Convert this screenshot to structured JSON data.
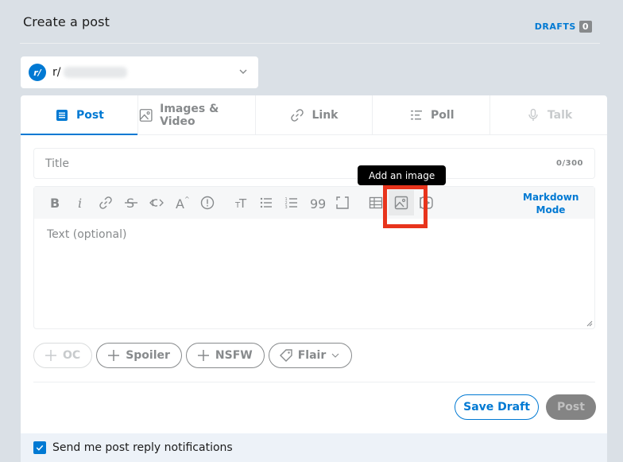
{
  "header": {
    "title": "Create a post",
    "drafts_label": "DRAFTS",
    "drafts_count": "0"
  },
  "community": {
    "avatar_text": "r/",
    "prefix": "r/"
  },
  "tabs": [
    {
      "label": "Post",
      "icon": "post-icon",
      "state": "active"
    },
    {
      "label": "Images & Video",
      "icon": "image-icon",
      "state": "normal"
    },
    {
      "label": "Link",
      "icon": "link-icon",
      "state": "normal"
    },
    {
      "label": "Poll",
      "icon": "poll-icon",
      "state": "normal"
    },
    {
      "label": "Talk",
      "icon": "microphone-icon",
      "state": "disabled"
    }
  ],
  "title_field": {
    "placeholder": "Title",
    "char_count": "0/300"
  },
  "tooltip": {
    "text": "Add an image"
  },
  "toolbar": {
    "markdown_mode_line1": "Markdown",
    "markdown_mode_line2": "Mode",
    "buttons": [
      "bold-icon",
      "italic-icon",
      "link-icon",
      "strikethrough-icon",
      "inline-code-icon",
      "superscript-icon",
      "spoiler-icon",
      "heading-icon",
      "bulleted-list-icon",
      "numbered-list-icon",
      "quote-block-icon",
      "code-block-icon",
      "table-icon",
      "image-icon",
      "video-icon"
    ]
  },
  "editor": {
    "placeholder": "Text (optional)"
  },
  "tags": {
    "oc": "OC",
    "spoiler": "Spoiler",
    "nsfw": "NSFW",
    "flair": "Flair"
  },
  "actions": {
    "save_draft": "Save Draft",
    "post": "Post"
  },
  "notifications": {
    "label": "Send me post reply notifications",
    "checked": true
  },
  "colors": {
    "accent": "#0079d3",
    "highlight": "#e8341c",
    "background": "#dae0e6"
  }
}
